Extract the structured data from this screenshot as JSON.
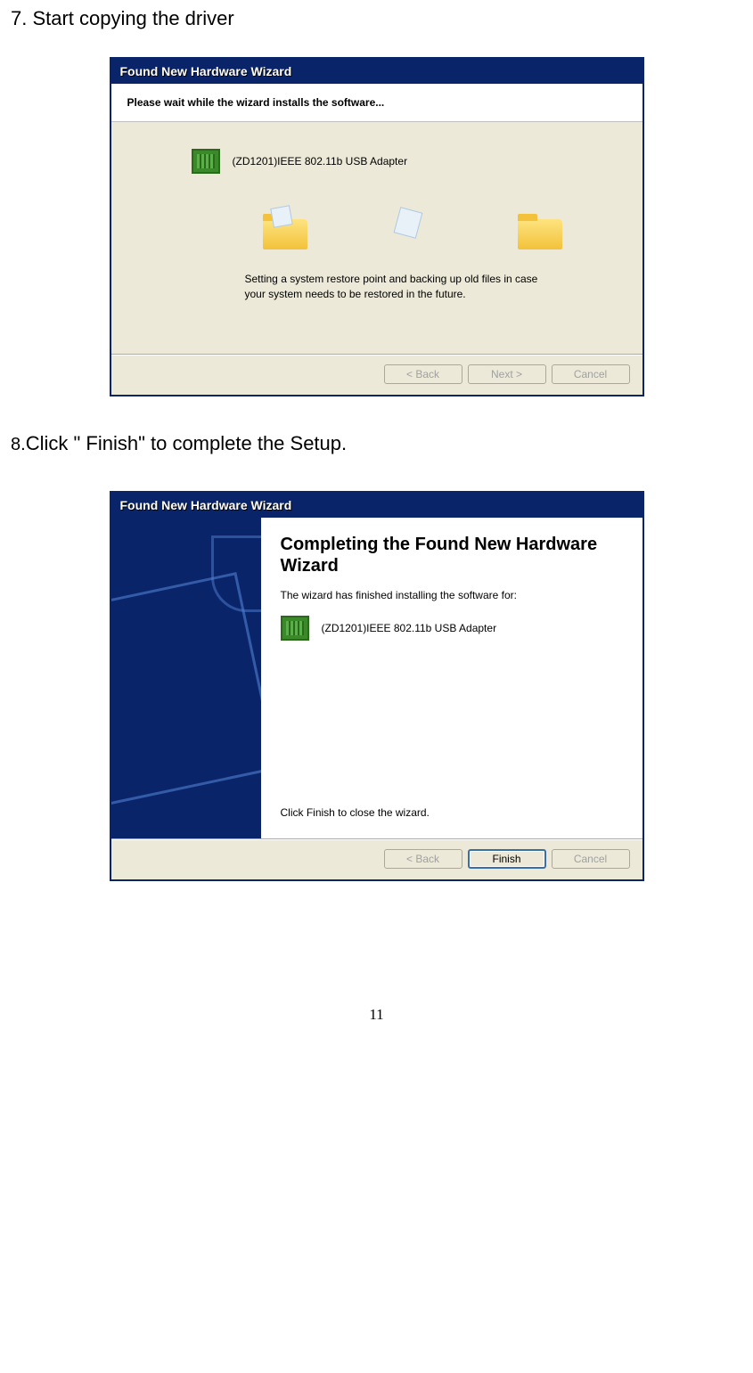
{
  "step7_text": "7. Start copying the driver",
  "step8_prefix": "8.",
  "step8_text": "Click \" Finish\"  to complete the Setup.",
  "dialog1": {
    "title": "Found New Hardware Wizard",
    "header": "Please wait while the wizard installs the software...",
    "device": "(ZD1201)IEEE 802.11b USB Adapter",
    "status": "Setting a system restore point and backing up old files in case your system needs to be restored in the future.",
    "back": "< Back",
    "next": "Next >",
    "cancel": "Cancel"
  },
  "dialog2": {
    "title": "Found New Hardware Wizard",
    "heading": "Completing the Found New Hardware Wizard",
    "sub": "The wizard has finished installing the software for:",
    "device": "(ZD1201)IEEE 802.11b USB Adapter",
    "close": "Click Finish to close the wizard.",
    "back": "< Back",
    "finish": "Finish",
    "cancel": "Cancel"
  },
  "page_number": "11"
}
